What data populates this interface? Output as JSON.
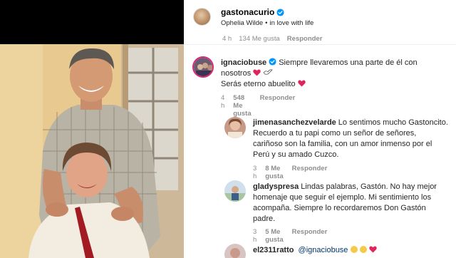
{
  "header": {
    "username": "gastonacurio",
    "song": "Ophelia Wilde",
    "separator": "•",
    "song_sub": "in love with life"
  },
  "hidden_meta": {
    "time": "4 h",
    "likes": "134 Me gusta",
    "reply": "Responder"
  },
  "comments": [
    {
      "username": "ignaciobuse",
      "text_line1": "Siempre llevaremos una parte de él con",
      "text_line2": "nosotros",
      "text_line3": "Serás eterno abuelito",
      "time": "4 h",
      "likes": "548 Me gusta",
      "reply": "Responder"
    },
    {
      "username": "jimenasanchezvelarde",
      "text_line1": "Lo sentimos mucho Gastoncito.",
      "text_line2": "Recuerdo a tu papi como un señor de señores,",
      "text_line3": "cariñoso son la familia, con un amor inmenso por el",
      "text_line4": "Perú y su amado Cuzco.",
      "time": "3 h",
      "likes": "8 Me gusta",
      "reply": "Responder"
    },
    {
      "username": "gladyspresa",
      "text_line1": "Lindas palabras, Gastón. No hay mejor",
      "text_line2": "homenaje que seguir el ejemplo. Mi sentimiento los",
      "text_line3": "acompaña. Siempre lo recordaremos Don Gastón",
      "text_line4": "padre.",
      "time": "3 h",
      "likes": "5 Me gusta",
      "reply": "Responder"
    },
    {
      "username": "el2311ratto",
      "mention": "@ignaciobuse"
    }
  ],
  "colors": {
    "verified": "#0095f6",
    "heart": "#e0245e",
    "secondary_text": "#8e8e8e"
  },
  "icons": {
    "verified": "verified-badge-icon",
    "heart": "red-heart-icon",
    "dove": "dove-icon"
  }
}
